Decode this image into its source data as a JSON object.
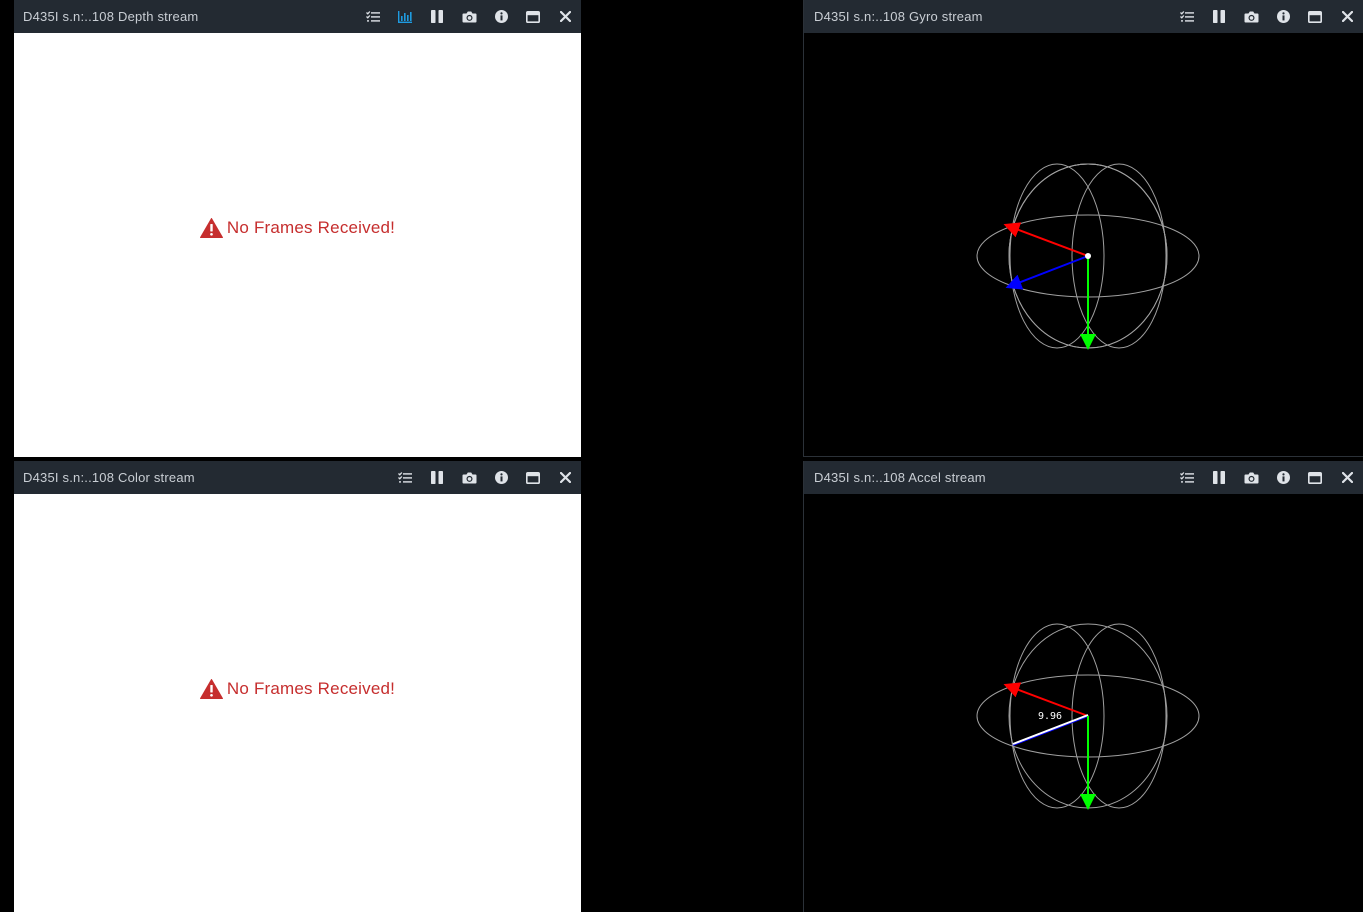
{
  "colors": {
    "titlebar_bg": "#232a32",
    "title_text": "#c9ced4",
    "icon": "#dfe3e8",
    "icon_active": "#1e9be0",
    "warning": "#c62e2e",
    "axis_x": "#ff0000",
    "axis_y": "#00ff00",
    "axis_z": "#0000ff",
    "rings": "#a0a0a0"
  },
  "depth": {
    "title": "D435I s.n:..108 Depth stream",
    "message": "No Frames Received!",
    "tools": [
      "settings-list-icon",
      "metrics-icon",
      "pause-icon",
      "camera-icon",
      "info-icon",
      "maximize-icon",
      "close-icon"
    ]
  },
  "color": {
    "title": "D435I s.n:..108 Color stream",
    "message": "No Frames Received!",
    "tools": [
      "settings-list-icon",
      "pause-icon",
      "camera-icon",
      "info-icon",
      "maximize-icon",
      "close-icon"
    ]
  },
  "gyro": {
    "title": "D435I s.n:..108 Gyro stream",
    "tools": [
      "settings-list-icon",
      "pause-icon",
      "camera-icon",
      "info-icon",
      "maximize-icon",
      "close-icon"
    ]
  },
  "accel": {
    "title": "D435I s.n:..108 Accel stream",
    "vector_label": "9.96",
    "tools": [
      "settings-list-icon",
      "pause-icon",
      "camera-icon",
      "info-icon",
      "maximize-icon",
      "close-icon"
    ]
  }
}
